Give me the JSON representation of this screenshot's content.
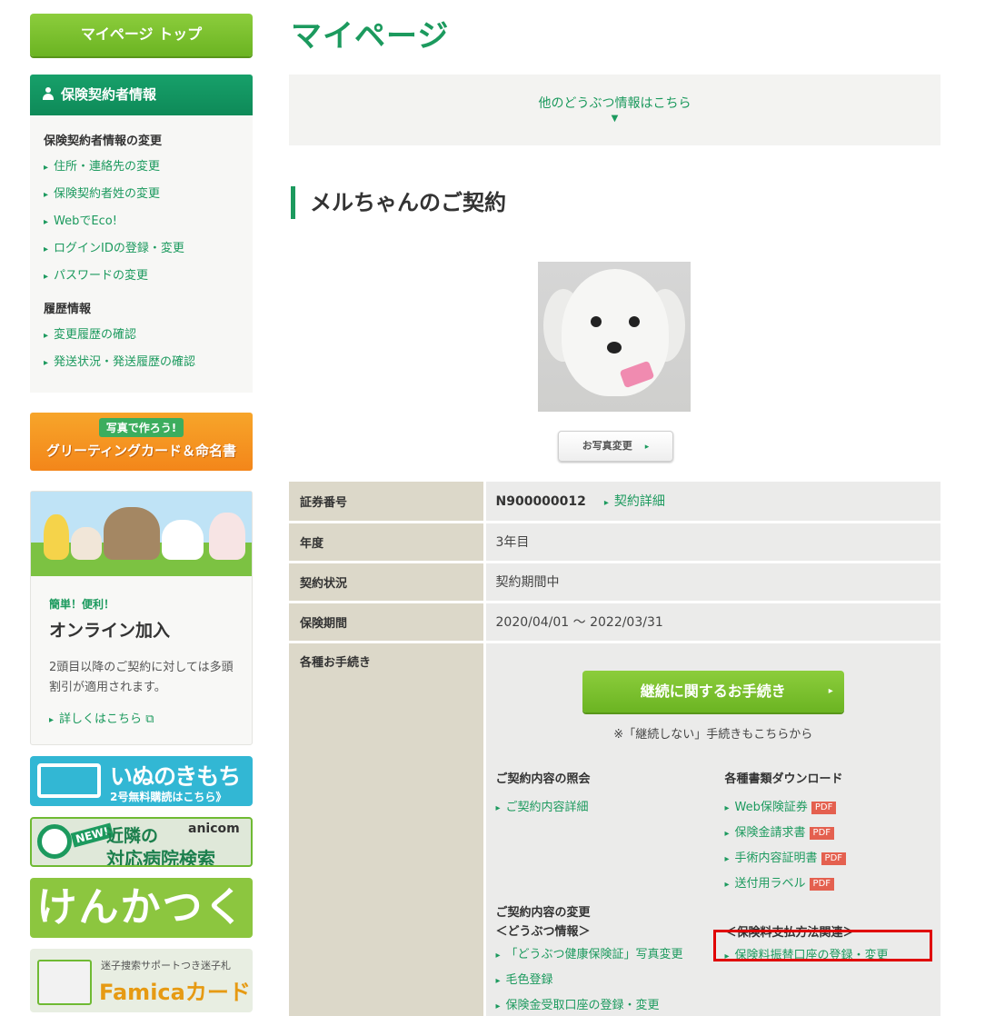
{
  "sidebar": {
    "mypage_top": "マイページ トップ",
    "contractor_panel": {
      "title": "保険契約者情報",
      "section1_title": "保険契約者情報の変更",
      "section1_items": [
        "住所・連絡先の変更",
        "保険契約者姓の変更",
        "WebでEco!",
        "ログインIDの登録・変更",
        "パスワードの変更"
      ],
      "section2_title": "履歴情報",
      "section2_items": [
        "変更履歴の確認",
        "発送状況・発送履歴の確認"
      ]
    },
    "greeting_banner": {
      "tag": "写真で作ろう!",
      "text": "グリーティングカード＆命名書"
    },
    "online": {
      "small": "簡単！便利！",
      "title": "オンライン加入",
      "desc": "2頭目以降のご契約に対しては多頭割引が適用されます。",
      "more": "詳しくはこちら"
    },
    "inu_banner": {
      "title": "いぬのきもち",
      "sub": "2号無料購読はこちら》"
    },
    "hospital_banner": {
      "new": "NEW!",
      "line1": "近隣の",
      "brand": "anicom",
      "line2": "対応病院検索"
    },
    "kenkatsu_banner": "けんかつくん",
    "famica_banner": {
      "sub": "迷子捜索サポートつき迷子札",
      "title": "Famicaカード"
    }
  },
  "main": {
    "page_title": "マイページ",
    "other_animals": "他のどうぶつ情報はこちら",
    "contract_heading": "メルちゃんのご契約",
    "photo_change": "お写真変更",
    "table": {
      "cert_label": "証券番号",
      "cert_value": "N900000012",
      "detail_link": "契約詳細",
      "year_label": "年度",
      "year_value": "3年目",
      "status_label": "契約状況",
      "status_value": "契約期間中",
      "period_label": "保険期間",
      "period_value": "2020/04/01 ～ 2022/03/31",
      "proc_label": "各種お手続き"
    },
    "renew_button": "継続に関するお手続き",
    "renew_note": "※「継続しない」手続きもこちらから",
    "inquiry": {
      "title": "ご契約内容の照会",
      "items": [
        "ご契約内容詳細"
      ]
    },
    "downloads": {
      "title": "各種書類ダウンロード",
      "items": [
        "Web保険証券",
        "保険金請求書",
        "手術内容証明書",
        "送付用ラベル"
      ],
      "pdf": "PDF"
    },
    "change": {
      "title": "ご契約内容の変更",
      "sub": "＜どうぶつ情報＞",
      "items": [
        "「どうぶつ健康保険証」写真変更",
        "毛色登録",
        "保険金受取口座の登録・変更"
      ]
    },
    "payment": {
      "sub": "＜保険料支払方法関連＞",
      "items": [
        "保険料振替口座の登録・変更"
      ]
    }
  },
  "colors": {
    "brand_green": "#1c9a5e",
    "button_green": "#6bb422",
    "highlight_red": "#e00000",
    "pdf_red": "#e4604f"
  }
}
